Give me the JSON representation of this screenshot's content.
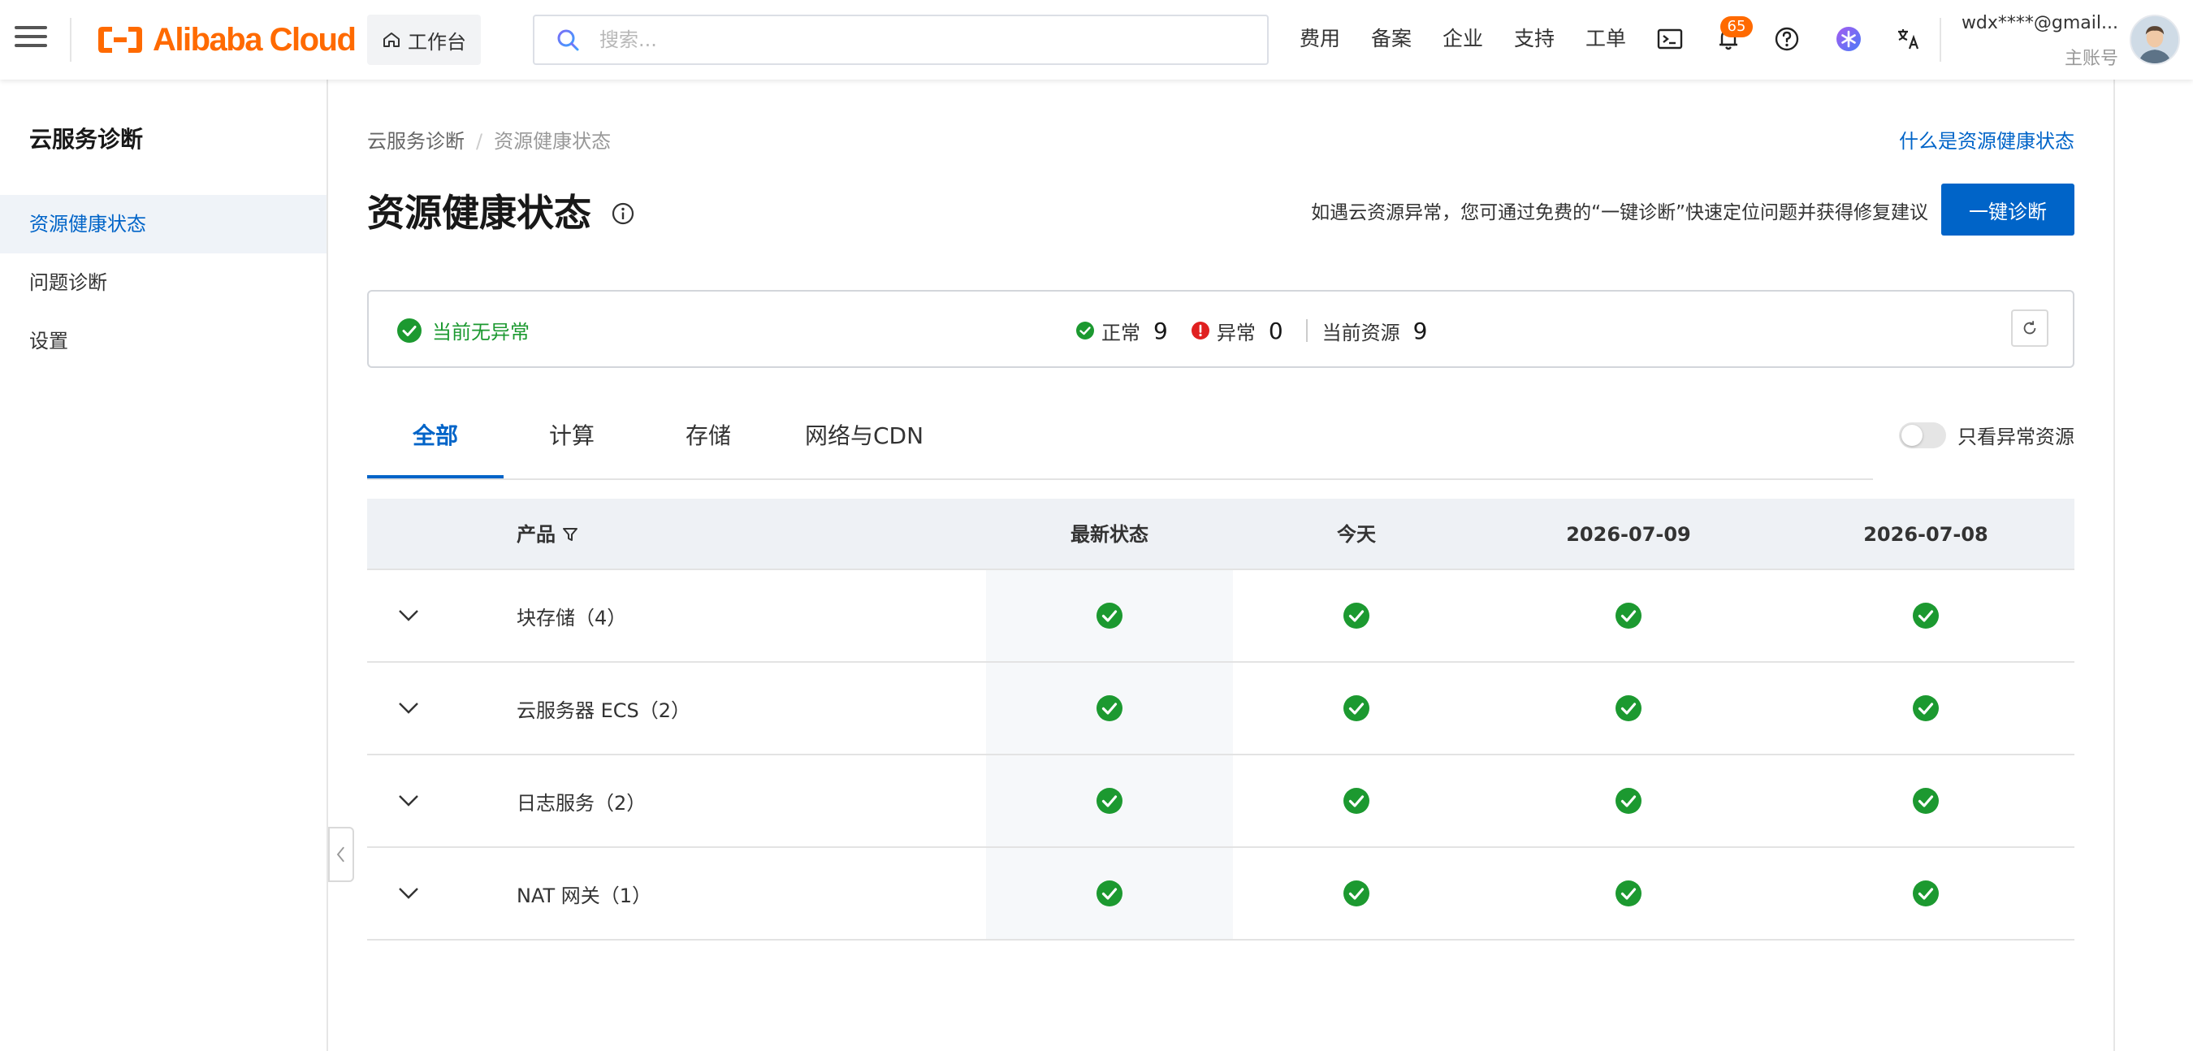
{
  "topbar": {
    "brand": "Alibaba Cloud",
    "workbench_label": "工作台",
    "search_placeholder": "搜索...",
    "nav": [
      "费用",
      "备案",
      "企业",
      "支持",
      "工单"
    ],
    "notification_count": "65",
    "user_email": "wdx****@gmail...",
    "user_role": "主账号",
    "brand_color": "#ff6a00"
  },
  "sidebar": {
    "title": "云服务诊断",
    "items": [
      {
        "label": "资源健康状态",
        "active": true
      },
      {
        "label": "问题诊断",
        "active": false
      },
      {
        "label": "设置",
        "active": false
      }
    ]
  },
  "breadcrumb": {
    "parent": "云服务诊断",
    "current": "资源健康状态"
  },
  "help_link": "什么是资源健康状态",
  "page_title": "资源健康状态",
  "diagnose": {
    "hint": "如遇云资源异常，您可通过免费的“一键诊断”快速定位问题并获得修复建议",
    "button_label": "一键诊断",
    "button_color": "#0064c8"
  },
  "status": {
    "summary": "当前无异常",
    "normal_label": "正常",
    "normal_count": "9",
    "abnormal_label": "异常",
    "abnormal_count": "0",
    "resources_label": "当前资源",
    "resources_count": "9",
    "ok_color": "#1c9930",
    "error_color": "#e02020"
  },
  "tabs": [
    {
      "label": "全部",
      "active": true
    },
    {
      "label": "计算",
      "active": false
    },
    {
      "label": "存储",
      "active": false
    },
    {
      "label": "网络与CDN",
      "active": false
    }
  ],
  "filter_toggle": {
    "label": "只看异常资源",
    "on": false
  },
  "table": {
    "columns": [
      "产品",
      "最新状态",
      "今天",
      "2026-07-09",
      "2026-07-08"
    ],
    "rows": [
      {
        "product": "块存储（4）",
        "statuses": [
          "ok",
          "ok",
          "ok",
          "ok"
        ]
      },
      {
        "product": "云服务器 ECS（2）",
        "statuses": [
          "ok",
          "ok",
          "ok",
          "ok"
        ]
      },
      {
        "product": "日志服务（2）",
        "statuses": [
          "ok",
          "ok",
          "ok",
          "ok"
        ]
      },
      {
        "product": "NAT 网关（1）",
        "statuses": [
          "ok",
          "ok",
          "ok",
          "ok"
        ]
      }
    ]
  }
}
